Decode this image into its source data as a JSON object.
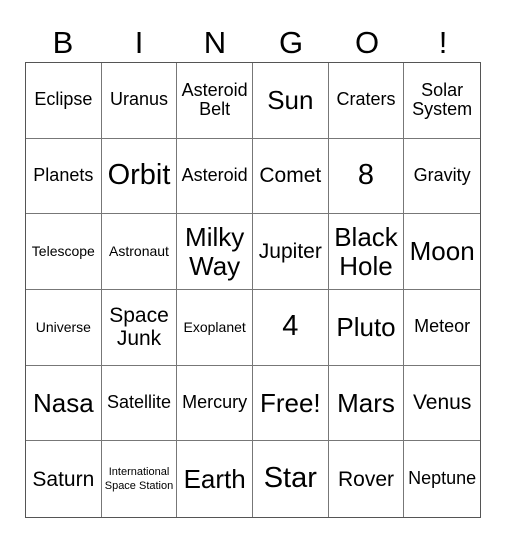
{
  "header": [
    "B",
    "I",
    "N",
    "G",
    "O",
    "!"
  ],
  "cells": [
    "Eclipse",
    "Uranus",
    "Asteroid Belt",
    "Sun",
    "Craters",
    "Solar System",
    "Planets",
    "Orbit",
    "Asteroid",
    "Comet",
    "8",
    "Gravity",
    "Telescope",
    "Astronaut",
    "Milky Way",
    "Jupiter",
    "Black Hole",
    "Moon",
    "Universe",
    "Space Junk",
    "Exoplanet",
    "4",
    "Pluto",
    "Meteor",
    "Nasa",
    "Satellite",
    "Mercury",
    "Free!",
    "Mars",
    "Venus",
    "Saturn",
    "International Space Station",
    "Earth",
    "Star",
    "Rover",
    "Neptune"
  ]
}
